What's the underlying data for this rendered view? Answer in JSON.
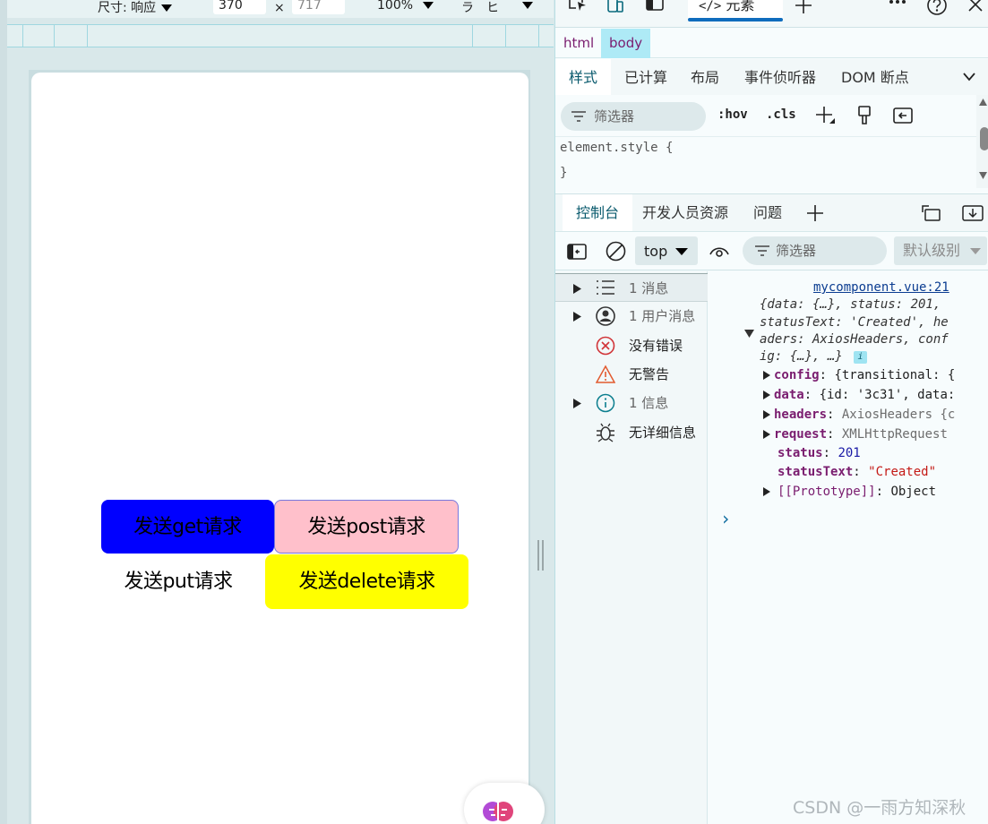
{
  "device_toolbar": {
    "dimensions_label": "尺寸: 响应",
    "width_value": "370",
    "times": "×",
    "height_value": "717",
    "zoom": "100%",
    "more_glyph": "ラ",
    "throttle_glyph": "ヒ"
  },
  "app": {
    "buttons": {
      "get": "发送get请求",
      "post": "发送post请求",
      "put": "发送put请求",
      "delete": "发送delete请求"
    },
    "colors": {
      "get": "#0000ff",
      "post": "#ffc0cb",
      "delete": "#ffff00"
    }
  },
  "devtools": {
    "tab_elements": "元素",
    "breadcrumb": [
      "html",
      "body"
    ],
    "style_tabs": [
      "样式",
      "已计算",
      "布局",
      "事件侦听器",
      "DOM 断点"
    ],
    "filter_placeholder": "筛选器",
    "hov": ":hov",
    "cls": ".cls",
    "style_rule_open": "element.style {",
    "style_rule_close": "}",
    "drawer_tabs": [
      "控制台",
      "开发人员资源",
      "问题"
    ],
    "context": "top",
    "console_filter_placeholder": "筛选器",
    "log_level": "默认级别",
    "sidebar": [
      {
        "label": "1 消息",
        "icon": "list-icon"
      },
      {
        "label": "1 用户消息",
        "icon": "user-icon"
      },
      {
        "label": "没有错误",
        "icon": "error-icon"
      },
      {
        "label": "无警告",
        "icon": "warning-icon"
      },
      {
        "label": "1 信息",
        "icon": "info-icon"
      },
      {
        "label": "无详细信息",
        "icon": "bug-icon"
      }
    ],
    "console": {
      "source": "mycomponent.vue:21",
      "summary": [
        "{data: {…}, status: 201,",
        "statusText: 'Created', he",
        "aders: AxiosHeaders, conf",
        "ig: {…}, …}"
      ],
      "props": [
        {
          "key": "config",
          "value": "{transitional: {",
          "expandable": true
        },
        {
          "key": "data",
          "value": "{id: '3c31', data:",
          "expandable": true
        },
        {
          "key": "headers",
          "value": "AxiosHeaders {c",
          "expandable": true
        },
        {
          "key": "request",
          "value": "XMLHttpRequest",
          "expandable": true
        },
        {
          "key": "status",
          "value": "201",
          "expandable": false
        },
        {
          "key": "statusText",
          "value": "\"Created\"",
          "expandable": false
        },
        {
          "key": "[[Prototype]]",
          "value": "Object",
          "expandable": true
        }
      ],
      "prompt": "›"
    }
  },
  "watermark": "CSDN @一雨方知深秋"
}
